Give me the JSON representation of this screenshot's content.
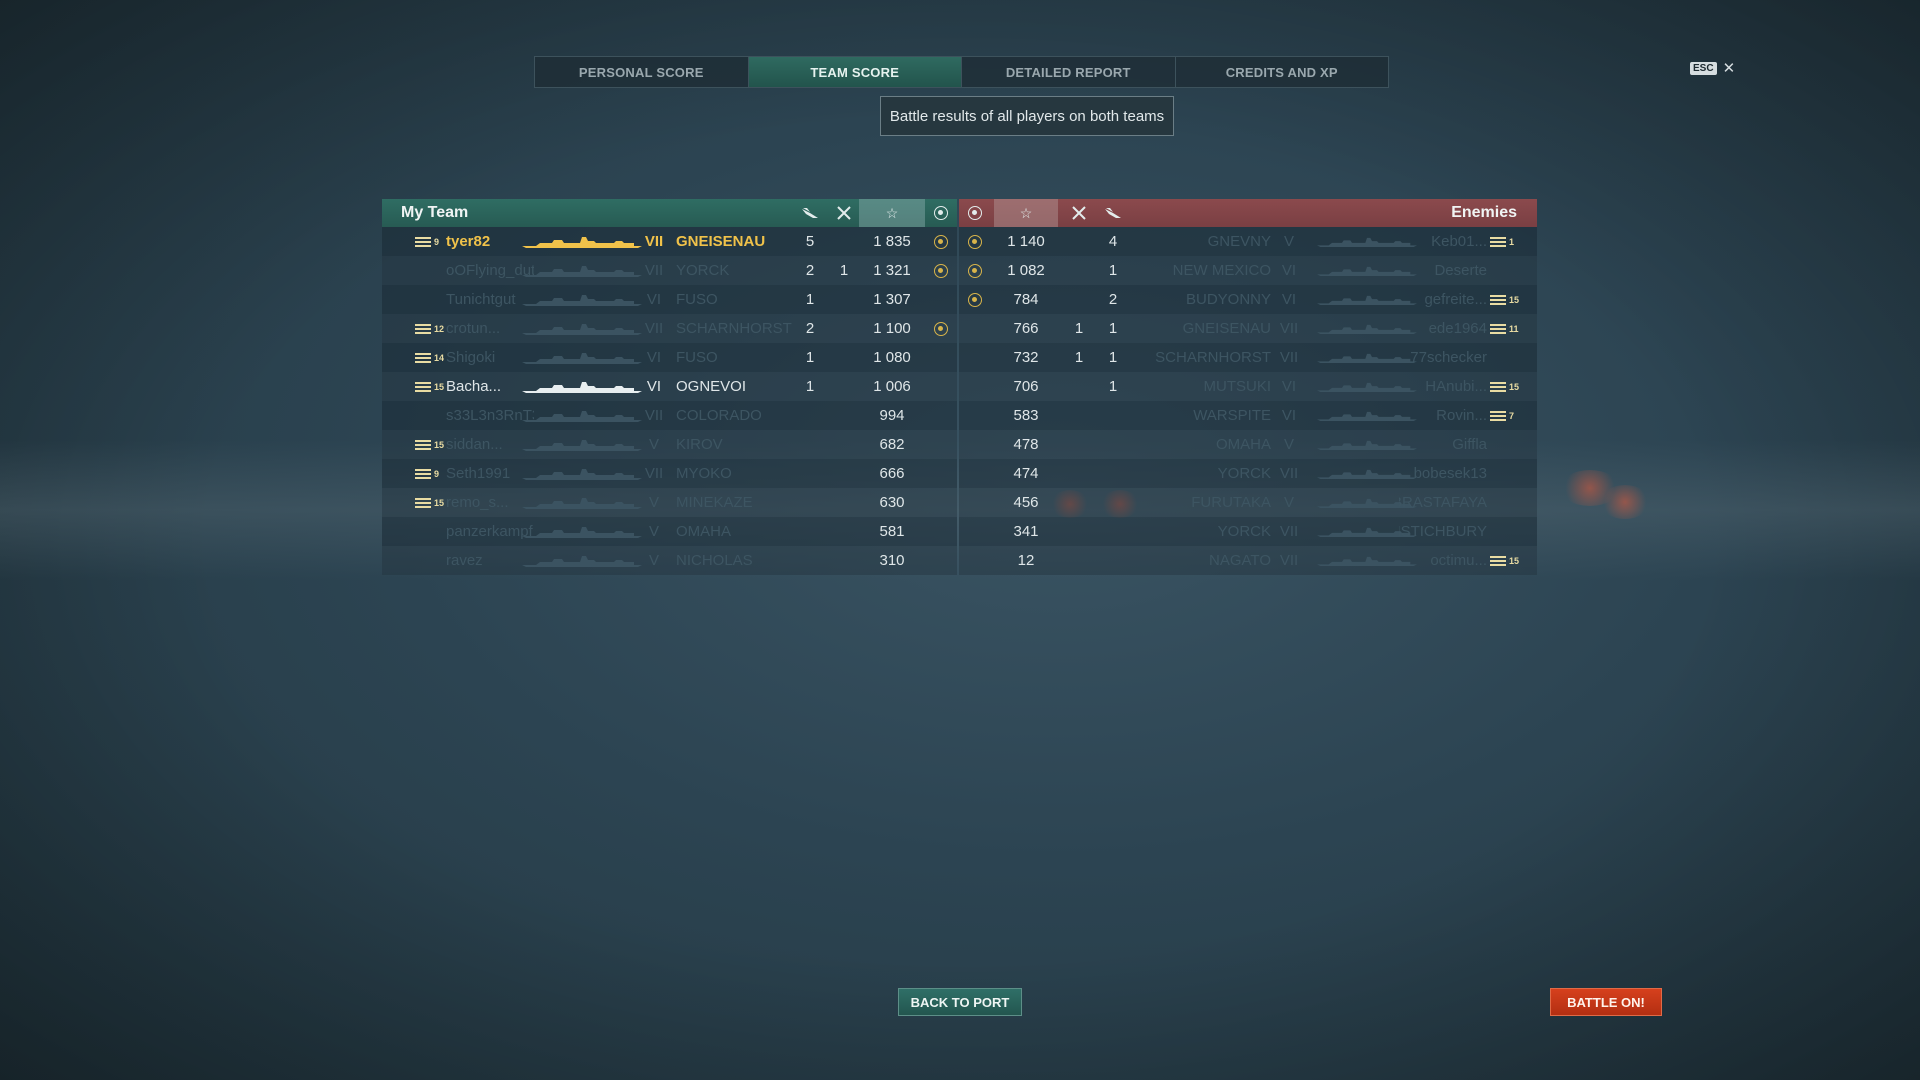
{
  "tabs": [
    {
      "label": "PERSONAL SCORE",
      "active": false
    },
    {
      "label": "TEAM SCORE",
      "active": true
    },
    {
      "label": "DETAILED REPORT",
      "active": false
    },
    {
      "label": "CREDITS AND XP",
      "active": false
    }
  ],
  "close": {
    "key": "ESC",
    "symbol": "✕"
  },
  "tooltip": "Battle results of all players on both teams",
  "my_team": {
    "title": "My Team",
    "rows": [
      {
        "player": "tyer82",
        "rank": "9",
        "tier": "VII",
        "ship": "GNEISENAU",
        "kills": "5",
        "planes": "",
        "xp": "1 835",
        "medal": true,
        "style": "gold"
      },
      {
        "player": "oOFlying_dut...",
        "rank": "",
        "tier": "VII",
        "ship": "YORCK",
        "kills": "2",
        "planes": "1",
        "xp": "1 321",
        "medal": true,
        "style": "dim"
      },
      {
        "player": "Tunichtgut",
        "rank": "",
        "tier": "VI",
        "ship": "FUSO",
        "kills": "1",
        "planes": "",
        "xp": "1 307",
        "medal": false,
        "style": "dim"
      },
      {
        "player": "crotun...",
        "rank": "12",
        "tier": "VII",
        "ship": "SCHARNHORST",
        "kills": "2",
        "planes": "",
        "xp": "1 100",
        "medal": true,
        "style": "dim"
      },
      {
        "player": "Shigoki",
        "rank": "14",
        "tier": "VI",
        "ship": "FUSO",
        "kills": "1",
        "planes": "",
        "xp": "1 080",
        "medal": false,
        "style": "dim"
      },
      {
        "player": "Bacha...",
        "rank": "15",
        "tier": "VI",
        "ship": "OGNEVOI",
        "kills": "1",
        "planes": "",
        "xp": "1 006",
        "medal": false,
        "style": "lit"
      },
      {
        "player": "s33L3n3RnT3",
        "rank": "",
        "tier": "VII",
        "ship": "COLORADO",
        "kills": "",
        "planes": "",
        "xp": "994",
        "medal": false,
        "style": "dim"
      },
      {
        "player": "siddan...",
        "rank": "15",
        "tier": "V",
        "ship": "KIROV",
        "kills": "",
        "planes": "",
        "xp": "682",
        "medal": false,
        "style": "dim"
      },
      {
        "player": "Seth1991",
        "rank": "9",
        "tier": "VII",
        "ship": "MYOKO",
        "kills": "",
        "planes": "",
        "xp": "666",
        "medal": false,
        "style": "dim"
      },
      {
        "player": "remo_s...",
        "rank": "15",
        "tier": "V",
        "ship": "MINEKAZE",
        "kills": "",
        "planes": "",
        "xp": "630",
        "medal": false,
        "style": "dim"
      },
      {
        "player": "panzerkampf...",
        "rank": "",
        "tier": "V",
        "ship": "OMAHA",
        "kills": "",
        "planes": "",
        "xp": "581",
        "medal": false,
        "style": "dim"
      },
      {
        "player": "ravez",
        "rank": "",
        "tier": "V",
        "ship": "NICHOLAS",
        "kills": "",
        "planes": "",
        "xp": "310",
        "medal": false,
        "style": "dim"
      }
    ]
  },
  "enemies": {
    "title": "Enemies",
    "rows": [
      {
        "player": "Keb01...",
        "rank": "1",
        "tier": "V",
        "ship": "GNEVNY",
        "kills": "4",
        "planes": "",
        "xp": "1 140",
        "medal": true
      },
      {
        "player": "Deserte",
        "rank": "",
        "tier": "VI",
        "ship": "NEW MEXICO",
        "kills": "1",
        "planes": "",
        "xp": "1 082",
        "medal": true
      },
      {
        "player": "gefreite...",
        "rank": "15",
        "tier": "VI",
        "ship": "BUDYONNY",
        "kills": "2",
        "planes": "",
        "xp": "784",
        "medal": true
      },
      {
        "player": "ede1964",
        "rank": "11",
        "tier": "VII",
        "ship": "GNEISENAU",
        "kills": "1",
        "planes": "1",
        "xp": "766",
        "medal": false
      },
      {
        "player": "77schecker",
        "rank": "",
        "tier": "VII",
        "ship": "SCHARNHORST",
        "kills": "1",
        "planes": "1",
        "xp": "732",
        "medal": false
      },
      {
        "player": "HAnubi...",
        "rank": "15",
        "tier": "VI",
        "ship": "MUTSUKI",
        "kills": "1",
        "planes": "",
        "xp": "706",
        "medal": false
      },
      {
        "player": "Rovin...",
        "rank": "7",
        "tier": "VI",
        "ship": "WARSPITE",
        "kills": "",
        "planes": "",
        "xp": "583",
        "medal": false
      },
      {
        "player": "Giffla",
        "rank": "",
        "tier": "V",
        "ship": "OMAHA",
        "kills": "",
        "planes": "",
        "xp": "478",
        "medal": false
      },
      {
        "player": "bobesek13",
        "rank": "",
        "tier": "VII",
        "ship": "YORCK",
        "kills": "",
        "planes": "",
        "xp": "474",
        "medal": false
      },
      {
        "player": "7BRASTAFAYA",
        "rank": "",
        "tier": "V",
        "ship": "FURUTAKA",
        "kills": "",
        "planes": "",
        "xp": "456",
        "medal": false
      },
      {
        "player": "RHSTICHBURY",
        "rank": "",
        "tier": "VII",
        "ship": "YORCK",
        "kills": "",
        "planes": "",
        "xp": "341",
        "medal": false
      },
      {
        "player": "octimu...",
        "rank": "15",
        "tier": "VII",
        "ship": "NAGATO",
        "kills": "",
        "planes": "",
        "xp": "12",
        "medal": false
      }
    ]
  },
  "buttons": {
    "back": "BACK TO PORT",
    "battle": "BATTLE ON!"
  },
  "colors": {
    "my_team_header": "#2f6d63",
    "enemies_header": "#8b4a4d",
    "highlight_player": "#f0c24a",
    "battle_button": "#d6401d",
    "back_button": "#2f6f67"
  }
}
